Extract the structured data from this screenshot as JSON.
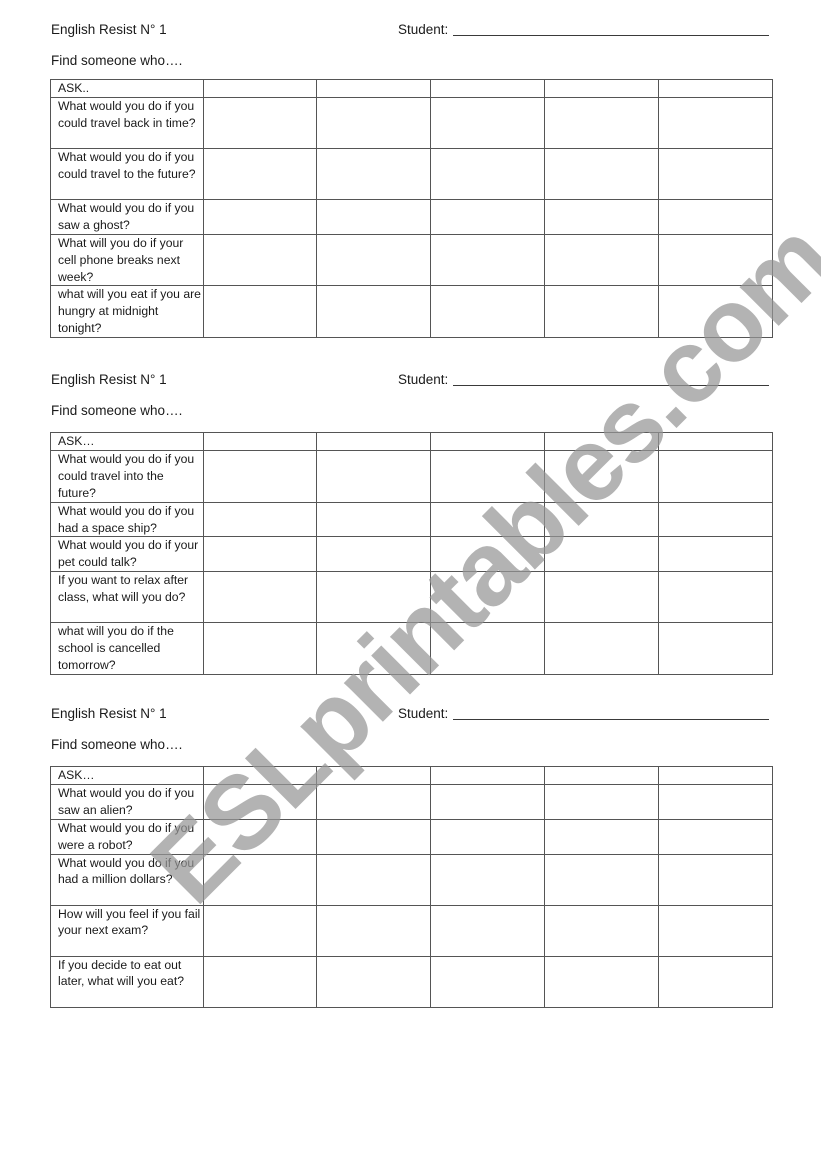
{
  "worksheets": [
    {
      "title": "English Resist N° 1",
      "student_label": "Student:",
      "subtitle": "Find someone who….",
      "rows": [
        {
          "question": "ASK..",
          "lines": 1
        },
        {
          "question": "What would you do if you could travel back in time?",
          "lines": 3
        },
        {
          "question": "What would you do if you could travel to the future?",
          "lines": 3
        },
        {
          "question": "What would you do if you saw a ghost?",
          "lines": 2
        },
        {
          "question": "What will you do if your cell phone breaks next week?",
          "lines": 3
        },
        {
          "question": "what will you eat if you are hungry at midnight tonight?",
          "lines": 3
        }
      ]
    },
    {
      "title": "English Resist N° 1",
      "student_label": "Student:",
      "subtitle": "Find someone who….",
      "rows": [
        {
          "question": "ASK…",
          "lines": 1
        },
        {
          "question": "What would you do if you could travel into the future?",
          "lines": 3
        },
        {
          "question": "What would you do if you had a space ship?",
          "lines": 2
        },
        {
          "question": "What would you do if your pet could talk?",
          "lines": 2
        },
        {
          "question": "If you want to relax after class, what will you do?",
          "lines": 3
        },
        {
          "question": "what will you do if the school is cancelled tomorrow?",
          "lines": 3
        }
      ]
    },
    {
      "title": "English Resist N° 1",
      "student_label": "Student:",
      "subtitle": "Find someone who….",
      "rows": [
        {
          "question": "ASK…",
          "lines": 1
        },
        {
          "question": "What would you do if you saw an alien?",
          "lines": 2
        },
        {
          "question": "What would you do if you were a robot?",
          "lines": 2
        },
        {
          "question": "What would you do if you had a million dollars?",
          "lines": 3
        },
        {
          "question": "How will you feel if you fail your next exam?",
          "lines": 3
        },
        {
          "question": "If you decide to eat out later, what will you eat?",
          "lines": 3
        }
      ]
    }
  ],
  "answer_columns_per_row": 5,
  "watermark": "ESLprintables.com"
}
